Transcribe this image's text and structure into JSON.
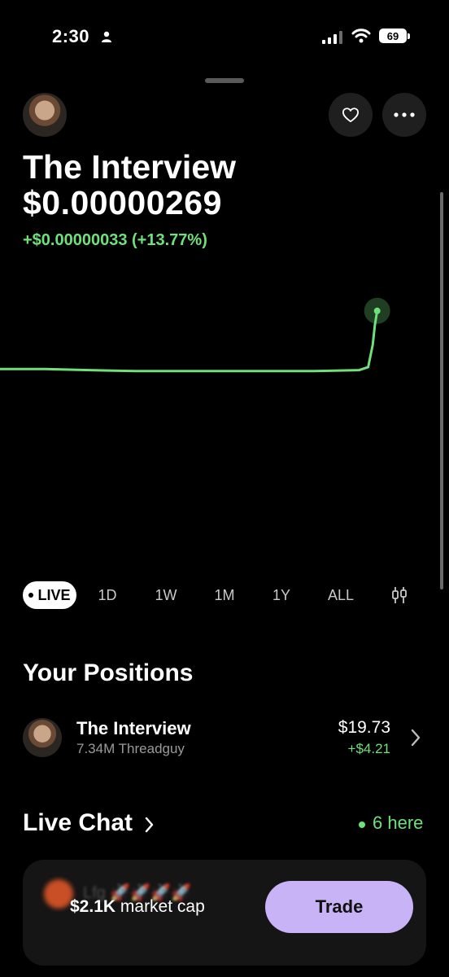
{
  "status_bar": {
    "time": "2:30",
    "battery": "69",
    "icons": [
      "person-icon",
      "signal-icon",
      "wifi-icon",
      "battery-icon"
    ]
  },
  "header": {
    "buttons": [
      "heart-icon",
      "more-icon"
    ]
  },
  "coin": {
    "name": "The Interview",
    "price": "$0.00000269",
    "change": "+$0.00000033 (+13.77%)"
  },
  "chart_data": {
    "type": "line",
    "title": "",
    "xlabel": "",
    "ylabel": "",
    "color": "#6fe07a",
    "x": [
      0,
      10,
      20,
      30,
      40,
      50,
      60,
      70,
      80,
      82,
      83,
      83.5,
      84
    ],
    "y": [
      2.4,
      2.4,
      2.395,
      2.39,
      2.39,
      2.39,
      2.39,
      2.39,
      2.395,
      2.41,
      2.52,
      2.62,
      2.69
    ],
    "xlim": [
      0,
      100
    ],
    "ylim": [
      1.4,
      2.9
    ],
    "grid": false,
    "last_point_marker": true
  },
  "ranges": {
    "live": "LIVE",
    "d1": "1D",
    "w1": "1W",
    "m1": "1M",
    "y1": "1Y",
    "all": "ALL",
    "selected": "LIVE",
    "chart_toggle_icon": "candlestick-icon"
  },
  "positions": {
    "title": "Your Positions",
    "items": [
      {
        "name": "The Interview",
        "subtitle": "7.34M Threadguy",
        "value": "$19.73",
        "gain": "+$4.21"
      }
    ]
  },
  "live_chat": {
    "title": "Live Chat",
    "here": "6 here",
    "preview_text": "Lfg 🚀🚀🚀🚀"
  },
  "bottom": {
    "market_cap_value": "$2.1K",
    "market_cap_label": "market cap",
    "trade_label": "Trade"
  },
  "colors": {
    "accent_green": "#6fe07a",
    "trade_purple": "#c8b3f7",
    "background": "#000000"
  }
}
